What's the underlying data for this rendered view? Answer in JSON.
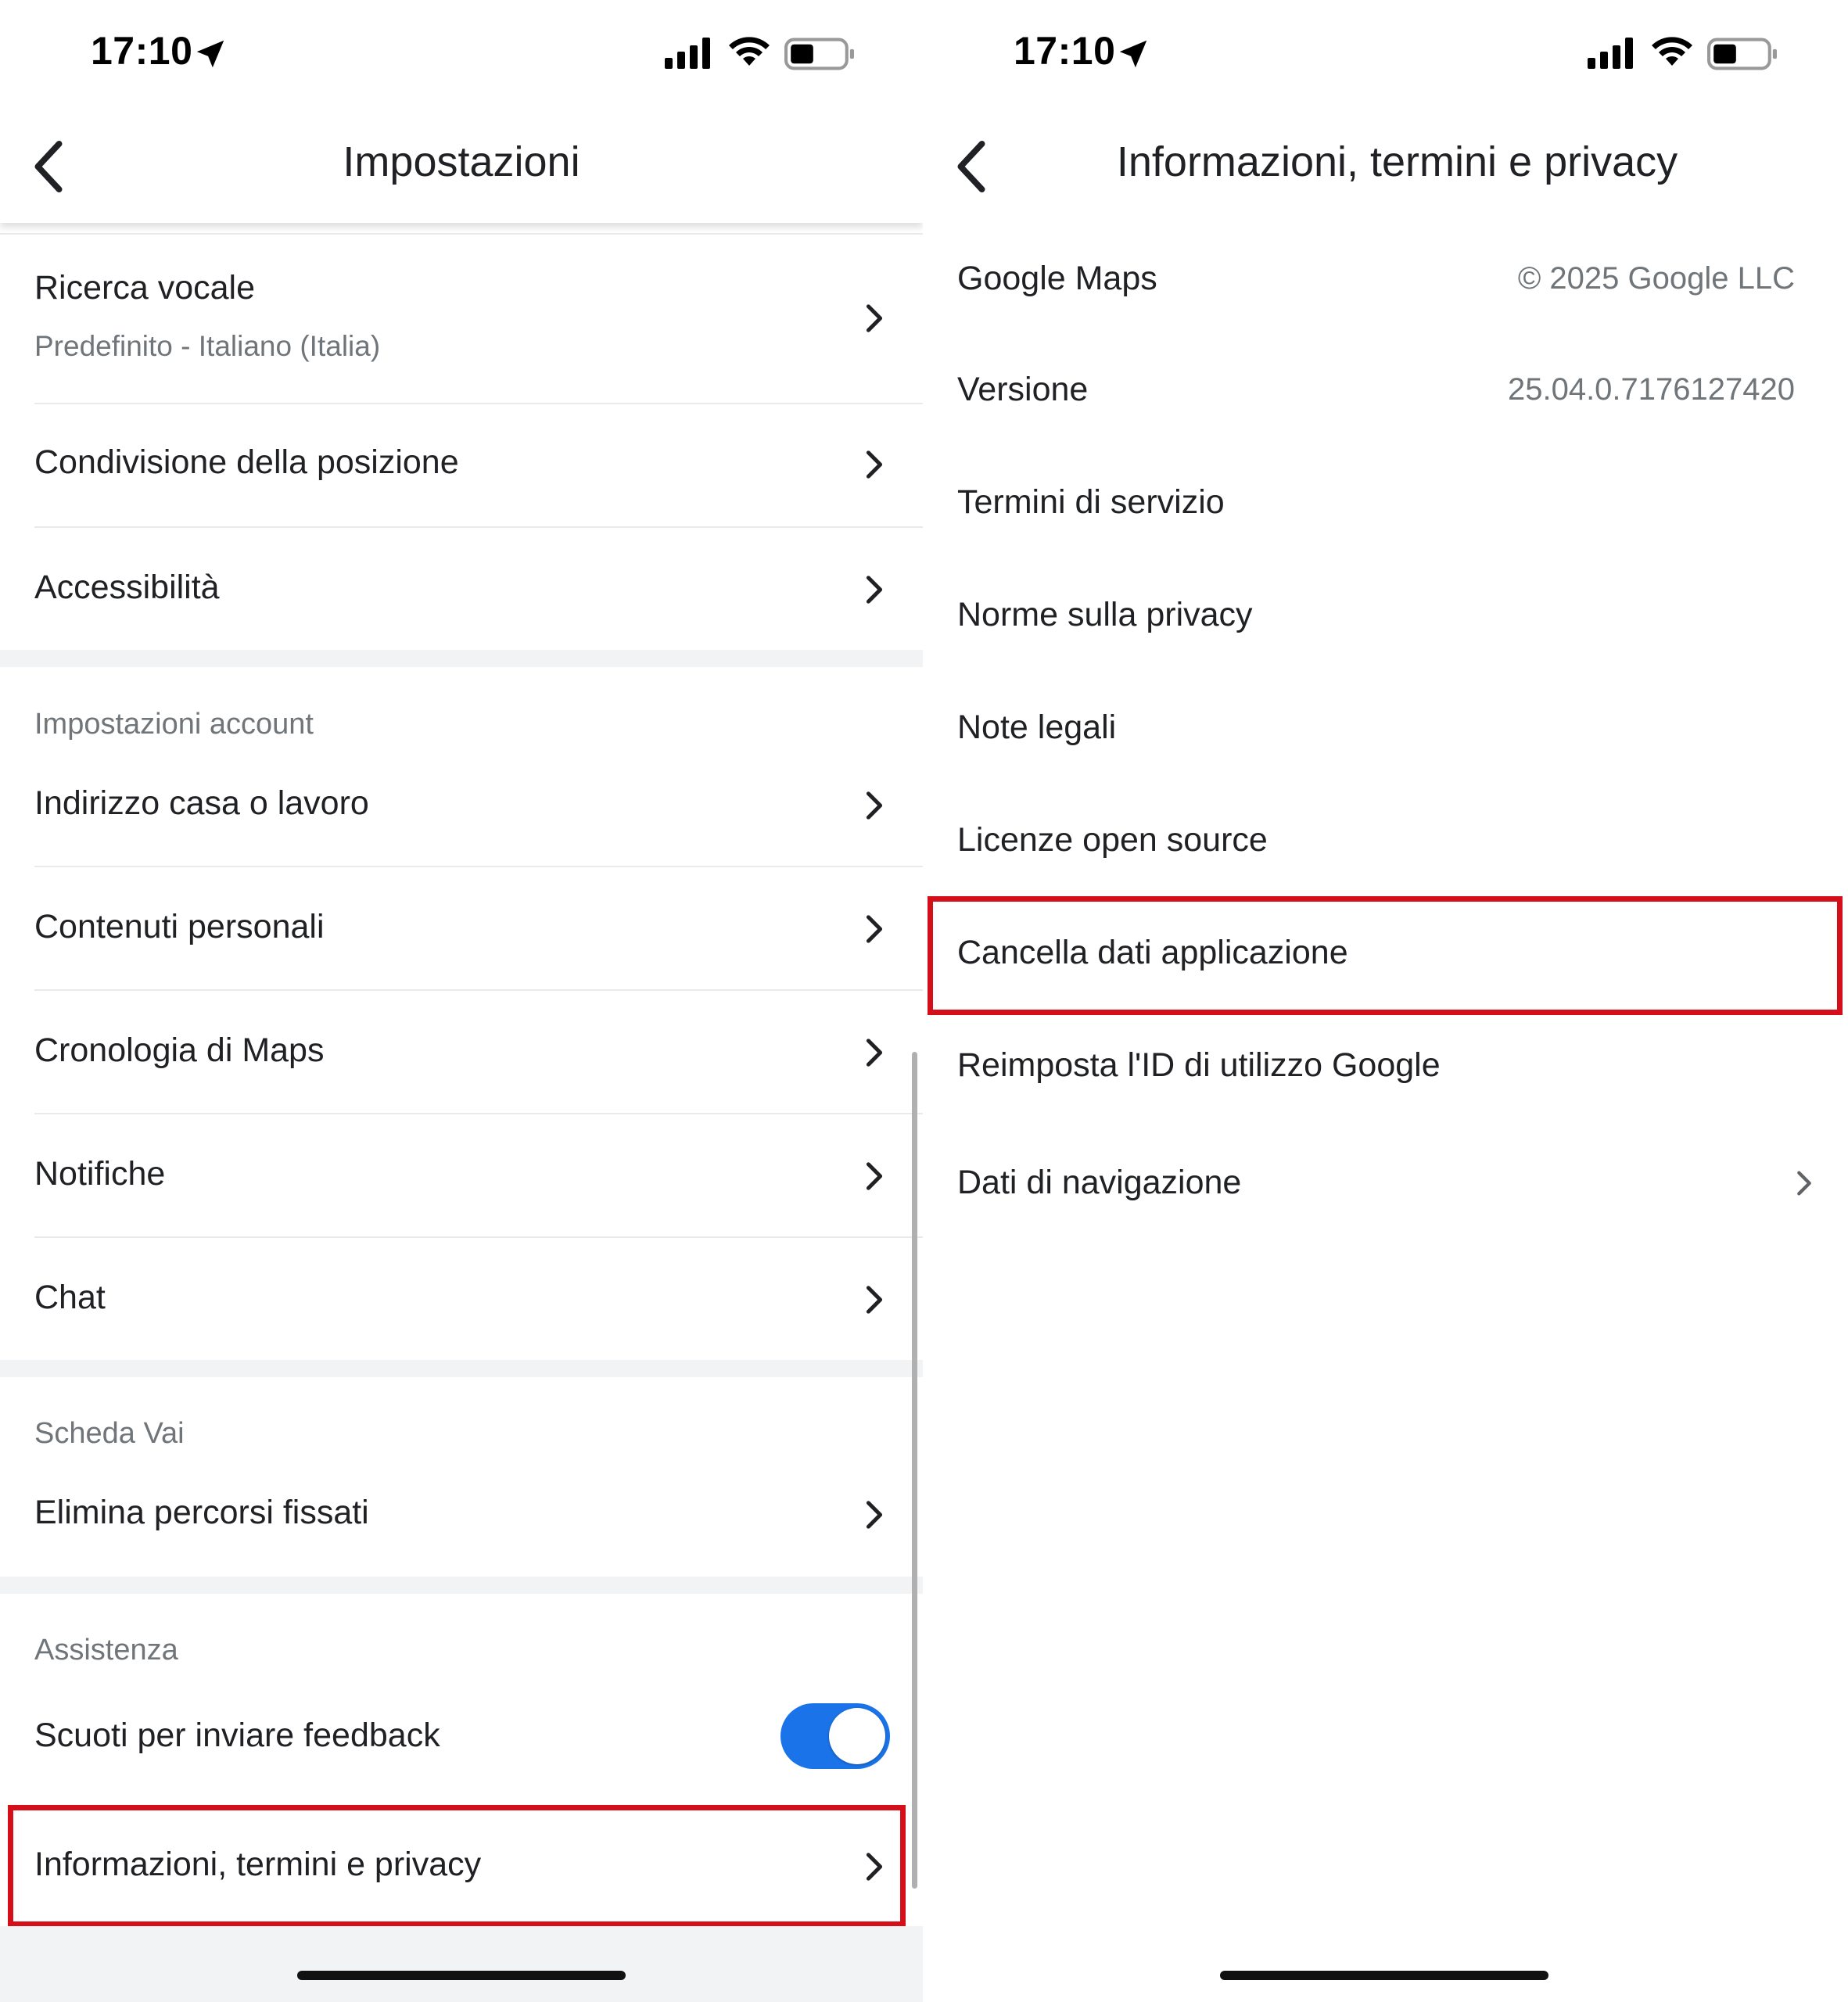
{
  "left": {
    "status": {
      "time": "17:10"
    },
    "header": {
      "title": "Impostazioni"
    },
    "voice_search": {
      "label": "Ricerca vocale",
      "sub": "Predefinito - Italiano (Italia)"
    },
    "items_top": [
      {
        "label": "Condivisione della posizione"
      },
      {
        "label": "Accessibilità"
      }
    ],
    "account": {
      "title": "Impostazioni account",
      "items": [
        {
          "label": "Indirizzo casa o lavoro"
        },
        {
          "label": "Contenuti personali"
        },
        {
          "label": "Cronologia di Maps"
        },
        {
          "label": "Notifiche"
        },
        {
          "label": "Chat"
        }
      ]
    },
    "go_tab": {
      "title": "Scheda Vai",
      "items": [
        {
          "label": "Elimina percorsi fissati"
        }
      ]
    },
    "support": {
      "title": "Assistenza",
      "shake_label": "Scuoti per inviare feedback",
      "shake_enabled": true,
      "about_label": "Informazioni, termini e privacy"
    }
  },
  "right": {
    "status": {
      "time": "17:10"
    },
    "header": {
      "title": "Informazioni, termini e privacy"
    },
    "items": [
      {
        "label": "Google Maps",
        "value": "© 2025 Google LLC"
      },
      {
        "label": "Versione",
        "value": "25.04.0.7176127420"
      },
      {
        "label": "Termini di servizio"
      },
      {
        "label": "Norme sulla privacy"
      },
      {
        "label": "Note legali"
      },
      {
        "label": "Licenze open source"
      },
      {
        "label": "Cancella dati applicazione"
      },
      {
        "label": "Reimposta l'ID di utilizzo Google"
      },
      {
        "label": "Dati di navigazione"
      }
    ]
  },
  "colors": {
    "accent": "#1a73e8",
    "highlight": "#d50f1a",
    "text": "#202124",
    "secondary": "#70757a"
  }
}
